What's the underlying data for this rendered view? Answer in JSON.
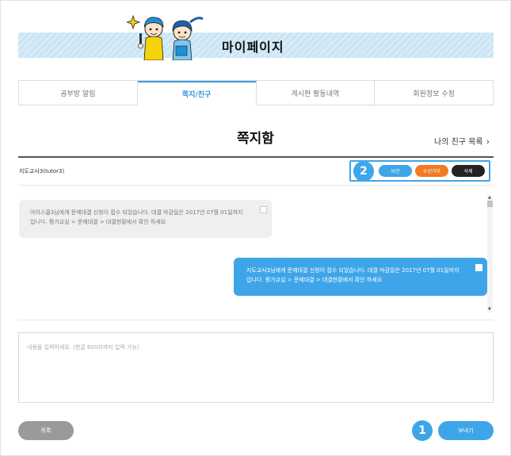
{
  "header": {
    "title": "마이페이지",
    "kids_icon": "kids-illustration-icon"
  },
  "tabs": [
    {
      "label": "공부방 알림",
      "active": false
    },
    {
      "label": "쪽지/친구",
      "active": true
    },
    {
      "label": "게시판 활동내역",
      "active": false
    },
    {
      "label": "회원정보 수정",
      "active": false
    }
  ],
  "page": {
    "heading": "쪽지함",
    "friend_link": "나의 친구 목록",
    "friend_link_icon": "chevron-right-icon"
  },
  "toolbar": {
    "from_user": "지도교사3(tutor3)",
    "badge_number": "2",
    "save_label": "보관",
    "block_label": "수신거부",
    "delete_label": "삭제"
  },
  "messages": [
    {
      "direction": "in",
      "text": "아이스클3님에게 문제대결 신청이 접수 되었습니다. 대결 마감일은 2017년 07월 01일까지 입니다. 평가교실 > 문제대결 > 대결현황에서 확인 하세요"
    },
    {
      "direction": "out",
      "text": "지도교사3님에게 문제대결 신청이 접수 되었습니다. 대결 마감일은 2017년 07월 01일까지 입니다. 평가교실 > 문제대결 > 대결현황에서 확인 하세요"
    }
  ],
  "compose": {
    "placeholder": "내용을 입력하세요. (한글 600자까지 입력 가능)"
  },
  "footer": {
    "list_label": "목록",
    "send_label": "보내기",
    "badge_number": "1"
  },
  "colors": {
    "accent": "#3ea6e8",
    "block_button": "#f07a25",
    "delete_button": "#222222",
    "list_button": "#9a9a9a"
  }
}
